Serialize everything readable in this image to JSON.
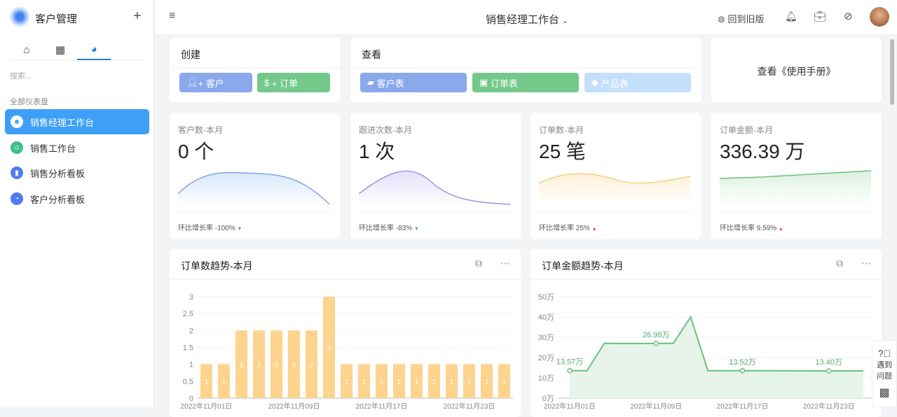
{
  "app": {
    "name": "客户管理",
    "add": "+"
  },
  "sidebar": {
    "search_placeholder": "搜索...",
    "group": "全部仪表盘",
    "items": [
      {
        "label": "销售经理工作台"
      },
      {
        "label": "销售工作台"
      },
      {
        "label": "销售分析看板"
      },
      {
        "label": "客户分析看板"
      }
    ]
  },
  "topbar": {
    "title": "销售经理工作台",
    "back_old": "回到旧版"
  },
  "create": {
    "title": "创建",
    "btn_customer": "+ 客户",
    "btn_order": "+ 订单"
  },
  "view": {
    "title": "查看",
    "btn_customer_table": "客户表",
    "btn_order_table": "订单表",
    "btn_product_table": "产品表"
  },
  "manual": {
    "label": "查看《使用手册》"
  },
  "stats": [
    {
      "label": "客户数-本月",
      "value": "0 个",
      "growth": "环比增长率 -100%",
      "dir": "down"
    },
    {
      "label": "跟进次数-本月",
      "value": "1 次",
      "growth": "环比增长率 -83%",
      "dir": "down"
    },
    {
      "label": "订单数-本月",
      "value": "25 笔",
      "growth": "环比增长率 25%",
      "dir": "up"
    },
    {
      "label": "订单金额-本月",
      "value": "336.39 万",
      "growth": "环比增长率 9.59%",
      "dir": "up"
    }
  ],
  "help": {
    "label1": "遇到",
    "label2": "问题"
  },
  "chart_data": [
    {
      "type": "bar",
      "title": "订单数趋势-本月",
      "ylim": [
        0,
        3
      ],
      "yticks": [
        "0",
        "0.5",
        "1",
        "1.5",
        "2",
        "2.5",
        "3"
      ],
      "xticks": [
        "2022年11月01日",
        "2022年11月09日",
        "2022年11月17日",
        "2022年11月23日"
      ],
      "values": [
        1,
        1,
        2,
        2,
        2,
        2,
        2,
        3,
        1,
        1,
        1,
        1,
        1,
        1,
        1,
        1,
        1,
        1
      ],
      "color": "#fdd38d"
    },
    {
      "type": "line",
      "title": "订单金额趋势-本月",
      "ylim": [
        0,
        50
      ],
      "yticks": [
        "0万",
        "10万",
        "20万",
        "30万",
        "40万",
        "50万"
      ],
      "xticks": [
        "2022年11月01日",
        "2022年11月09日",
        "2022年11月17日",
        "2022年11月23日"
      ],
      "values": [
        13.57,
        13.5,
        27,
        26.9,
        26.9,
        26.98,
        27,
        40,
        13.5,
        13.5,
        13.52,
        13.5,
        13.5,
        13.45,
        13.4,
        13.4,
        13.4,
        13.45
      ],
      "labels": {
        "0": "13.57万",
        "5": "26.98万",
        "10": "13.52万",
        "15": "13.40万"
      },
      "color": "#6cc07e"
    }
  ]
}
